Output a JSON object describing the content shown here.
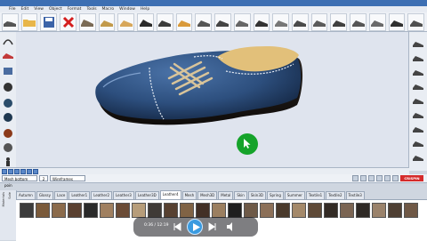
{
  "menu": [
    "File",
    "Edit",
    "View",
    "Object",
    "Format",
    "Tools",
    "Macro",
    "Window",
    "Help"
  ],
  "status": {
    "mesh_selector": "Mesh bottom poin",
    "count": "2",
    "render_mode": "Wireframes",
    "logo_text": "CRISPIN"
  },
  "material_tabs": [
    "Autumn",
    "Glossy",
    "Lace",
    "Leather1",
    "Leather2",
    "Leather3",
    "Leather3D",
    "Leather4",
    "Mesh",
    "Mesh3D",
    "Metal",
    "Skin",
    "Skin3D",
    "Spring",
    "Summer",
    "Textile1",
    "Textile2",
    "Textile3"
  ],
  "active_tab": "Leather4",
  "material_side_labels": [
    "Materials",
    "Sole"
  ],
  "media": {
    "timecode": "0:36 / 12:19"
  },
  "swatch_colors": [
    "#3b3b3b",
    "#7a5a3a",
    "#8b6b4b",
    "#5a4030",
    "#2a2a2a",
    "#a08060",
    "#6b4c36",
    "#b79d7a",
    "#3f3a36",
    "#574030",
    "#806345",
    "#423026",
    "#9b7f60",
    "#1e1e1e",
    "#6e5a48",
    "#8c7058",
    "#4a3a2c",
    "#a4896a",
    "#5e4937",
    "#332b25",
    "#7b6553",
    "#2f2a26",
    "#9a826b",
    "#4e3f33",
    "#6f5846"
  ],
  "colors": {
    "shoe_blue": "#2d4f7e",
    "play_button": "#3a9be0",
    "cursor_green": "#15a32a"
  }
}
